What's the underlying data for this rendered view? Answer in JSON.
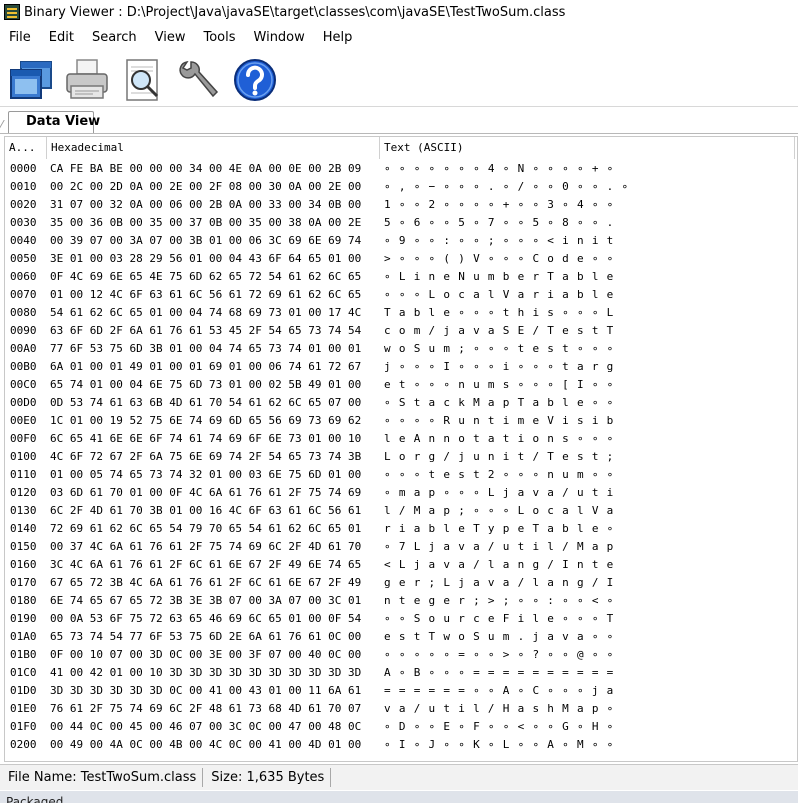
{
  "window": {
    "title": "Binary Viewer : D:\\Project\\Java\\javaSE\\target\\classes\\com\\javaSE\\TestTwoSum.class"
  },
  "menu": [
    "File",
    "Edit",
    "Search",
    "View",
    "Tools",
    "Window",
    "Help"
  ],
  "toolbar": {
    "icons": [
      "open-icon",
      "print-icon",
      "print-preview-icon",
      "settings-wrench-icon",
      "help-icon"
    ]
  },
  "tabs": [
    {
      "label": "Data View",
      "active": true
    }
  ],
  "columns": {
    "address": "A...",
    "hex": "Hexadecimal",
    "text": "Text (ASCII)"
  },
  "rows": [
    {
      "addr": "0000",
      "hex": "CA FE BA BE 00 00 00 34 00 4E 0A 00 0E 00 2B 09",
      "text": "∘ ∘ ∘ ∘ ∘ ∘ ∘ 4 ∘ N ∘ ∘ ∘ ∘ + ∘"
    },
    {
      "addr": "0010",
      "hex": "00 2C 00 2D 0A 00 2E 00 2F 08 00 30 0A 00 2E 00",
      "text": "∘ , ∘ − ∘ ∘ ∘ . ∘ / ∘ ∘ 0 ∘ ∘ . ∘"
    },
    {
      "addr": "0020",
      "hex": "31 07 00 32 0A 00 06 00 2B 0A 00 33 00 34 0B 00",
      "text": "1 ∘ ∘ 2 ∘ ∘ ∘ ∘ + ∘ ∘ 3 ∘ 4 ∘ ∘"
    },
    {
      "addr": "0030",
      "hex": "35 00 36 0B 00 35 00 37 0B 00 35 00 38 0A 00 2E",
      "text": "5 ∘ 6 ∘ ∘ 5 ∘ 7 ∘ ∘ 5 ∘ 8 ∘ ∘ ."
    },
    {
      "addr": "0040",
      "hex": "00 39 07 00 3A 07 00 3B 01 00 06 3C 69 6E 69 74",
      "text": "∘ 9 ∘ ∘ : ∘ ∘ ; ∘ ∘ ∘ < i n i t"
    },
    {
      "addr": "0050",
      "hex": "3E 01 00 03 28 29 56 01 00 04 43 6F 64 65 01 00",
      "text": "> ∘ ∘ ∘ ( ) V ∘ ∘ ∘ C o d e ∘ ∘"
    },
    {
      "addr": "0060",
      "hex": "0F 4C 69 6E 65 4E 75 6D 62 65 72 54 61 62 6C 65",
      "text": "∘ L i n e N u m b e r T a b l e"
    },
    {
      "addr": "0070",
      "hex": "01 00 12 4C 6F 63 61 6C 56 61 72 69 61 62 6C 65",
      "text": "∘ ∘ ∘ L o c a l V a r i a b l e"
    },
    {
      "addr": "0080",
      "hex": "54 61 62 6C 65 01 00 04 74 68 69 73 01 00 17 4C",
      "text": "T a b l e ∘ ∘ ∘ t h i s ∘ ∘ ∘ L"
    },
    {
      "addr": "0090",
      "hex": "63 6F 6D 2F 6A 61 76 61 53 45 2F 54 65 73 74 54",
      "text": "c o m / j a v a S E / T e s t T"
    },
    {
      "addr": "00A0",
      "hex": "77 6F 53 75 6D 3B 01 00 04 74 65 73 74 01 00 01",
      "text": "w o S u m ; ∘ ∘ ∘ t e s t ∘ ∘ ∘"
    },
    {
      "addr": "00B0",
      "hex": "6A 01 00 01 49 01 00 01 69 01 00 06 74 61 72 67",
      "text": "j ∘ ∘ ∘ I ∘ ∘ ∘ i ∘ ∘ ∘ t a r g"
    },
    {
      "addr": "00C0",
      "hex": "65 74 01 00 04 6E 75 6D 73 01 00 02 5B 49 01 00",
      "text": "e t ∘ ∘ ∘ n u m s ∘ ∘ ∘ [ I ∘ ∘"
    },
    {
      "addr": "00D0",
      "hex": "0D 53 74 61 63 6B 4D 61 70 54 61 62 6C 65 07 00",
      "text": "∘ S t a c k M a p T a b l e ∘ ∘"
    },
    {
      "addr": "00E0",
      "hex": "1C 01 00 19 52 75 6E 74 69 6D 65 56 69 73 69 62",
      "text": "∘ ∘ ∘ ∘ R u n t i m e V i s i b"
    },
    {
      "addr": "00F0",
      "hex": "6C 65 41 6E 6E 6F 74 61 74 69 6F 6E 73 01 00 10",
      "text": "l e A n n o t a t i o n s ∘ ∘ ∘"
    },
    {
      "addr": "0100",
      "hex": "4C 6F 72 67 2F 6A 75 6E 69 74 2F 54 65 73 74 3B",
      "text": "L o r g / j u n i t / T e s t ;"
    },
    {
      "addr": "0110",
      "hex": "01 00 05 74 65 73 74 32 01 00 03 6E 75 6D 01 00",
      "text": "∘ ∘ ∘ t e s t 2 ∘ ∘ ∘ n u m ∘ ∘"
    },
    {
      "addr": "0120",
      "hex": "03 6D 61 70 01 00 0F 4C 6A 61 76 61 2F 75 74 69",
      "text": "∘ m a p ∘ ∘ ∘ L j a v a / u t i"
    },
    {
      "addr": "0130",
      "hex": "6C 2F 4D 61 70 3B 01 00 16 4C 6F 63 61 6C 56 61",
      "text": "l / M a p ; ∘ ∘ ∘ L o c a l V a"
    },
    {
      "addr": "0140",
      "hex": "72 69 61 62 6C 65 54 79 70 65 54 61 62 6C 65 01",
      "text": "r i a b l e T y p e T a b l e ∘"
    },
    {
      "addr": "0150",
      "hex": "00 37 4C 6A 61 76 61 2F 75 74 69 6C 2F 4D 61 70",
      "text": "∘ 7 L j a v a / u t i l / M a p"
    },
    {
      "addr": "0160",
      "hex": "3C 4C 6A 61 76 61 2F 6C 61 6E 67 2F 49 6E 74 65",
      "text": "< L j a v a / l a n g / I n t e"
    },
    {
      "addr": "0170",
      "hex": "67 65 72 3B 4C 6A 61 76 61 2F 6C 61 6E 67 2F 49",
      "text": "g e r ; L j a v a / l a n g / I"
    },
    {
      "addr": "0180",
      "hex": "6E 74 65 67 65 72 3B 3E 3B 07 00 3A 07 00 3C 01",
      "text": "n t e g e r ; > ; ∘ ∘ : ∘ ∘ < ∘"
    },
    {
      "addr": "0190",
      "hex": "00 0A 53 6F 75 72 63 65 46 69 6C 65 01 00 0F 54",
      "text": "∘ ∘ S o u r c e F i l e ∘ ∘ ∘ T"
    },
    {
      "addr": "01A0",
      "hex": "65 73 74 54 77 6F 53 75 6D 2E 6A 61 76 61 0C 00",
      "text": "e s t T w o S u m . j a v a ∘ ∘"
    },
    {
      "addr": "01B0",
      "hex": "0F 00 10 07 00 3D 0C 00 3E 00 3F 07 00 40 0C 00",
      "text": "∘ ∘ ∘ ∘ ∘ = ∘ ∘ > ∘ ? ∘ ∘ @ ∘ ∘"
    },
    {
      "addr": "01C0",
      "hex": "41 00 42 01 00 10 3D 3D 3D 3D 3D 3D 3D 3D 3D 3D",
      "text": "A ∘ B ∘ ∘ ∘ = = = = = = = = = ="
    },
    {
      "addr": "01D0",
      "hex": "3D 3D 3D 3D 3D 3D 0C 00 41 00 43 01 00 11 6A 61",
      "text": "= = = = = = ∘ ∘ A ∘ C ∘ ∘ ∘ j a"
    },
    {
      "addr": "01E0",
      "hex": "76 61 2F 75 74 69 6C 2F 48 61 73 68 4D 61 70 07",
      "text": "v a / u t i l / H a s h M a p ∘"
    },
    {
      "addr": "01F0",
      "hex": "00 44 0C 00 45 00 46 07 00 3C 0C 00 47 00 48 0C",
      "text": "∘ D ∘ ∘ E ∘ F ∘ ∘ < ∘ ∘ G ∘ H ∘"
    },
    {
      "addr": "0200",
      "hex": "00 49 00 4A 0C 00 4B 00 4C 0C 00 41 00 4D 01 00",
      "text": "∘ I ∘ J ∘ ∘ K ∘ L ∘ ∘ A ∘ M ∘ ∘"
    }
  ],
  "status": {
    "file_name": "File Name: TestTwoSum.class",
    "size": "Size: 1,635 Bytes"
  },
  "taskbar": {
    "text": "Packaged"
  }
}
